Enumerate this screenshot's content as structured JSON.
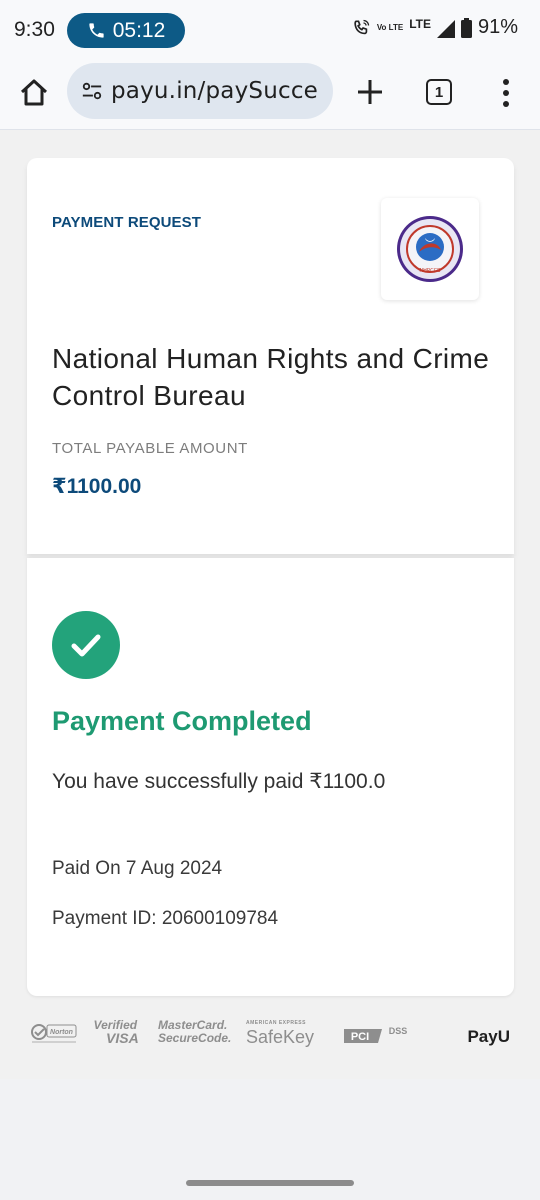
{
  "status_bar": {
    "time": "9:30",
    "call_timer": "05:12",
    "network_volte": "Vo LTE",
    "network": "LTE",
    "battery": "91%"
  },
  "browser": {
    "url": "payu.in/paySucce",
    "tab_count": "1"
  },
  "payment_request": {
    "label": "PAYMENT REQUEST",
    "logo_text": "NHRCCB",
    "merchant_name": "National Human Rights and Crime Control Bureau",
    "payable_label": "TOTAL PAYABLE AMOUNT",
    "payable_amount": "₹1100.00"
  },
  "result": {
    "title": "Payment Completed",
    "message": "You have successfully paid ₹1100.0",
    "paid_on": "Paid On 7 Aug 2024",
    "payment_id": "Payment ID: 20600109784"
  },
  "badges": {
    "norton": "Norton",
    "verified": "Verified",
    "visa": "VISA",
    "mastercard": "MasterCard.",
    "securecode": "SecureCode.",
    "amex": "AMERICAN EXPRESS",
    "safekey": "SafeKey",
    "pci": "PCI",
    "dss": "DSS",
    "payu": "PayU"
  },
  "colors": {
    "brand_blue": "#0d4a7a",
    "success_green": "#1e9a72",
    "call_pill": "#0d5a86"
  }
}
